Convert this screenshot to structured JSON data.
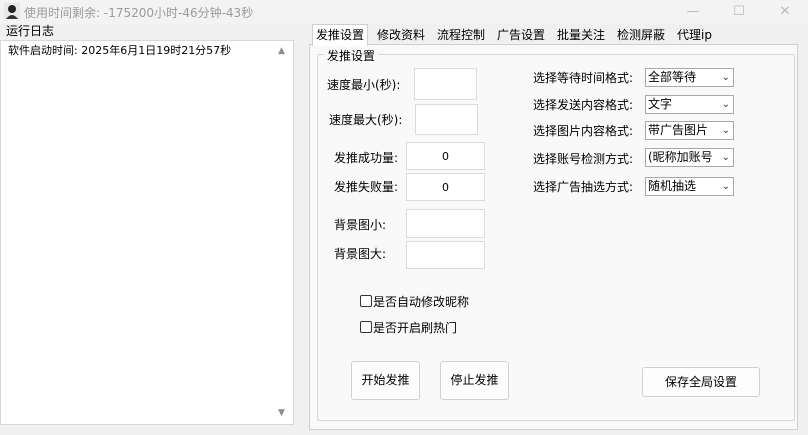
{
  "window": {
    "title": "使用时间剩余:  -175200小时-46分钟-43秒",
    "minimize_glyph": "—",
    "maximize_glyph": "☐",
    "close_glyph": "✕"
  },
  "log": {
    "title": "运行日志",
    "lines": [
      "软件启动时间: 2025年6月1日19时21分57秒"
    ],
    "scroll_up": "▲",
    "scroll_down": "▼"
  },
  "tabs": [
    {
      "label": "发推设置",
      "active": true
    },
    {
      "label": "修改资料",
      "active": false
    },
    {
      "label": "流程控制",
      "active": false
    },
    {
      "label": "广告设置",
      "active": false
    },
    {
      "label": "批量关注",
      "active": false
    },
    {
      "label": "检测屏蔽",
      "active": false
    },
    {
      "label": "代理ip",
      "active": false
    }
  ],
  "group": {
    "title": "发推设置",
    "speed_min_label": "速度最小(秒):",
    "speed_min_value": "",
    "speed_max_label": "速度最大(秒):",
    "speed_max_value": "",
    "success_label": "发推成功量:",
    "success_value": "0",
    "fail_label": "发推失败量:",
    "fail_value": "0",
    "bg_small_label": "背景图小:",
    "bg_small_value": "",
    "bg_large_label": "背景图大:",
    "bg_large_value": "",
    "checkboxes": [
      {
        "label": "是否自动修改昵称",
        "checked": false
      },
      {
        "label": "是否开启刷热门",
        "checked": false
      }
    ],
    "selects": [
      {
        "label": "选择等待时间格式:",
        "value": "全部等待"
      },
      {
        "label": "选择发送内容格式:",
        "value": "文字"
      },
      {
        "label": "选择图片内容格式:",
        "value": "带广告图片"
      },
      {
        "label": "选择账号检测方式:",
        "value": "(昵称加账号"
      },
      {
        "label": "选择广告抽选方式:",
        "value": "随机抽选"
      }
    ],
    "start_button": "开始发推",
    "stop_button": "停止发推",
    "save_button": "保存全局设置"
  }
}
